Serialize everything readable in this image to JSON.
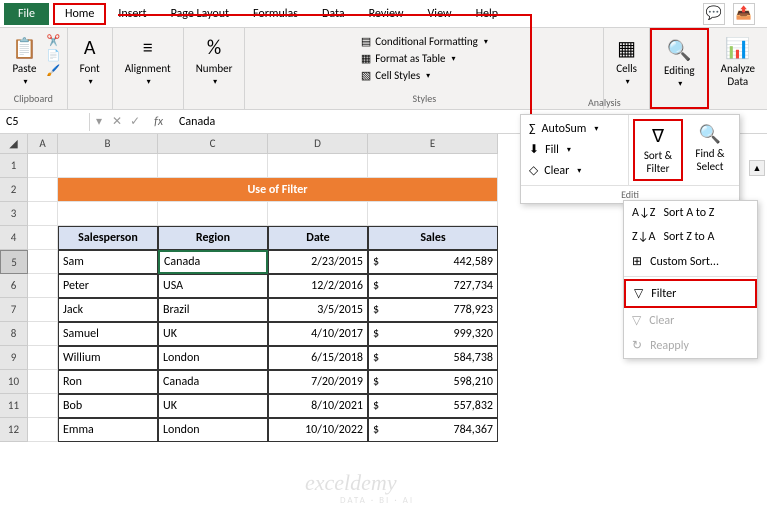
{
  "menu": {
    "file": "File",
    "home": "Home",
    "insert": "Insert",
    "pageLayout": "Page Layout",
    "formulas": "Formulas",
    "data": "Data",
    "review": "Review",
    "view": "View",
    "help": "Help"
  },
  "ribbon": {
    "clipboard": {
      "paste": "Paste",
      "label": "Clipboard"
    },
    "font": {
      "btn": "Font"
    },
    "alignment": {
      "btn": "Alignment"
    },
    "number": {
      "btn": "Number"
    },
    "styles": {
      "cond": "Conditional Formatting",
      "table": "Format as Table",
      "cellStyles": "Cell Styles",
      "label": "Styles"
    },
    "cells": {
      "btn": "Cells"
    },
    "editing": {
      "btn": "Editing"
    },
    "analysis": {
      "btn": "Analyze\nData",
      "label": "Analysis"
    }
  },
  "formulaBar": {
    "name": "C5",
    "value": "Canada"
  },
  "cols": [
    "A",
    "B",
    "C",
    "D",
    "E"
  ],
  "rows": [
    "1",
    "2",
    "3",
    "4",
    "5",
    "6",
    "7",
    "8",
    "9",
    "10",
    "11",
    "12"
  ],
  "title": "Use of Filter",
  "headers": {
    "sp": "Salesperson",
    "region": "Region",
    "date": "Date",
    "sales": "Sales"
  },
  "data": [
    {
      "sp": "Sam",
      "region": "Canada",
      "date": "2/23/2015",
      "cur": "$",
      "sales": "442,589"
    },
    {
      "sp": "Peter",
      "region": "USA",
      "date": "12/2/2016",
      "cur": "$",
      "sales": "727,734"
    },
    {
      "sp": "Jack",
      "region": "Brazil",
      "date": "3/5/2015",
      "cur": "$",
      "sales": "778,923"
    },
    {
      "sp": "Samuel",
      "region": "UK",
      "date": "4/10/2017",
      "cur": "$",
      "sales": "999,320"
    },
    {
      "sp": "Willium",
      "region": "London",
      "date": "6/15/2018",
      "cur": "$",
      "sales": "584,738"
    },
    {
      "sp": "Ron",
      "region": "Canada",
      "date": "7/20/2019",
      "cur": "$",
      "sales": "598,210"
    },
    {
      "sp": "Bob",
      "region": "UK",
      "date": "8/10/2021",
      "cur": "$",
      "sales": "557,832"
    },
    {
      "sp": "Emma",
      "region": "London",
      "date": "10/10/2022",
      "cur": "$",
      "sales": "784,367"
    }
  ],
  "editDrop": {
    "autosum": "AutoSum",
    "fill": "Fill",
    "clear": "Clear",
    "sortFilter": "Sort &\nFilter",
    "findSelect": "Find &\nSelect",
    "footer": "Editi"
  },
  "sortMenu": {
    "az": "Sort A to Z",
    "za": "Sort Z to A",
    "custom": "Custom Sort...",
    "filter": "Filter",
    "clear": "Clear",
    "reapply": "Reapply"
  },
  "watermark": "exceldemy",
  "watermarkSub": "DATA · BI · AI"
}
